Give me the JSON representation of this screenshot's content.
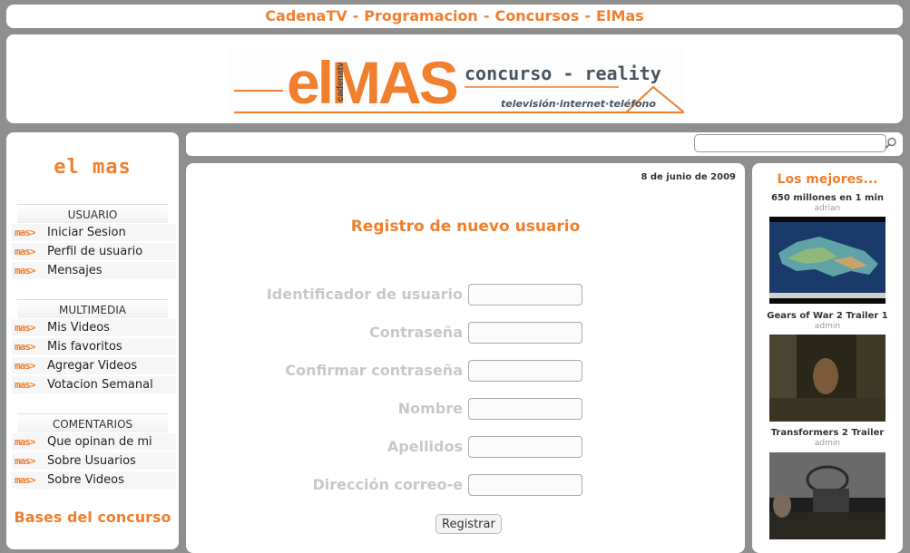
{
  "topnav": {
    "links": [
      "CadenaTV",
      "Programacion",
      "Concursos",
      "ElMas"
    ],
    "separator": "-"
  },
  "banner": {
    "logo_main": "elMAS",
    "logo_small": "cadenatv",
    "tagline": "concurso - reality",
    "subline": "televisión·internet·teléfono"
  },
  "sidebar": {
    "site_title": "el mas",
    "tag": "mas>",
    "sections": [
      {
        "title": "USUARIO",
        "items": [
          "Iniciar Sesion",
          "Perfil de usuario",
          "Mensajes"
        ]
      },
      {
        "title": "MULTIMEDIA",
        "items": [
          "Mis Videos",
          "Mis favoritos",
          "Agregar Videos",
          "Votacion Semanal"
        ]
      },
      {
        "title": "COMENTARIOS",
        "items": [
          "Que opinan de mi",
          "Sobre Usuarios",
          "Sobre Videos"
        ]
      }
    ],
    "bases_label": "Bases del concurso"
  },
  "search": {
    "value": ""
  },
  "main": {
    "date": "8 de junio de 2009",
    "form_title": "Registro de nuevo usuario",
    "fields": [
      "Identificador de usuario",
      "Contraseña",
      "Confirmar contraseña",
      "Nombre",
      "Apellidos",
      "Dirección correo-e"
    ],
    "submit_label": "Registrar"
  },
  "right": {
    "title": "Los mejores...",
    "videos": [
      {
        "title": "650 millones en 1 min",
        "author": "adrian"
      },
      {
        "title": "Gears of War 2 Trailer 1",
        "author": "admin"
      },
      {
        "title": "Transformers 2 Trailer",
        "author": "admin"
      }
    ]
  },
  "colors": {
    "accent": "#f07f2e",
    "page_bg": "#8f8f8f",
    "muted_label": "#c8c8c8"
  }
}
